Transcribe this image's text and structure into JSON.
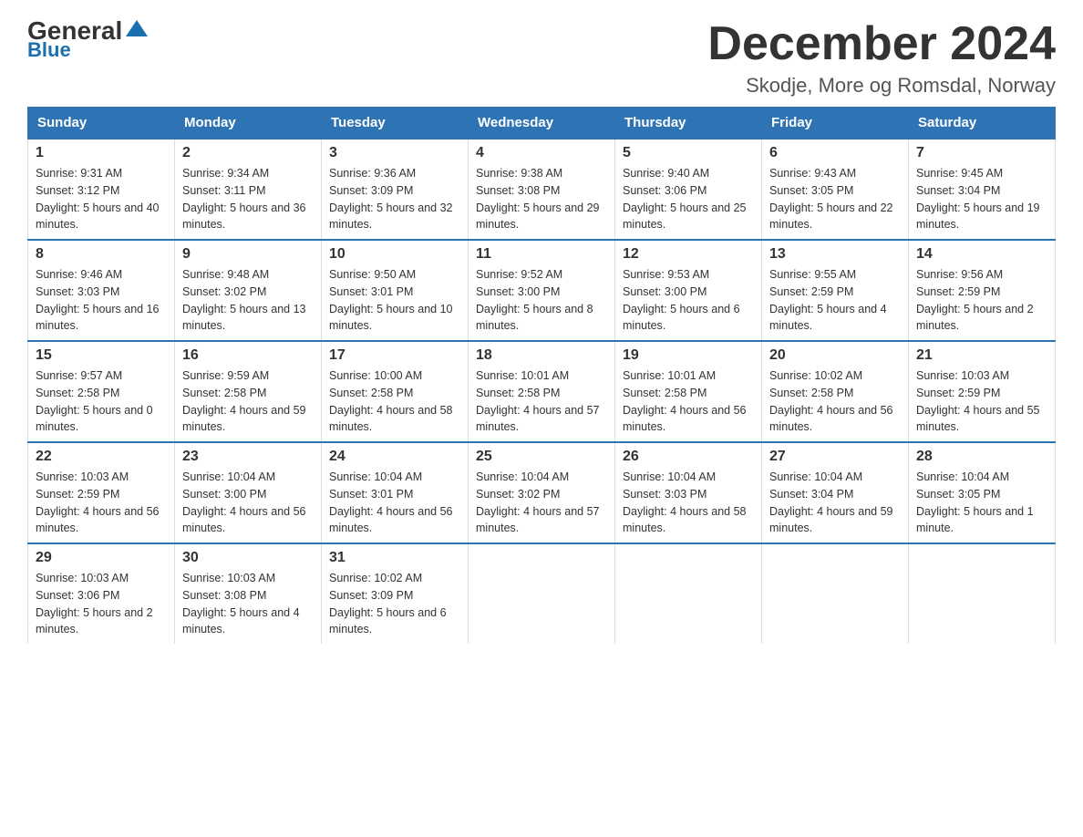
{
  "logo": {
    "general": "General",
    "blue": "Blue"
  },
  "header": {
    "month": "December 2024",
    "location": "Skodje, More og Romsdal, Norway"
  },
  "days_of_week": [
    "Sunday",
    "Monday",
    "Tuesday",
    "Wednesday",
    "Thursday",
    "Friday",
    "Saturday"
  ],
  "weeks": [
    [
      {
        "num": "1",
        "sunrise": "9:31 AM",
        "sunset": "3:12 PM",
        "daylight": "5 hours and 40 minutes."
      },
      {
        "num": "2",
        "sunrise": "9:34 AM",
        "sunset": "3:11 PM",
        "daylight": "5 hours and 36 minutes."
      },
      {
        "num": "3",
        "sunrise": "9:36 AM",
        "sunset": "3:09 PM",
        "daylight": "5 hours and 32 minutes."
      },
      {
        "num": "4",
        "sunrise": "9:38 AM",
        "sunset": "3:08 PM",
        "daylight": "5 hours and 29 minutes."
      },
      {
        "num": "5",
        "sunrise": "9:40 AM",
        "sunset": "3:06 PM",
        "daylight": "5 hours and 25 minutes."
      },
      {
        "num": "6",
        "sunrise": "9:43 AM",
        "sunset": "3:05 PM",
        "daylight": "5 hours and 22 minutes."
      },
      {
        "num": "7",
        "sunrise": "9:45 AM",
        "sunset": "3:04 PM",
        "daylight": "5 hours and 19 minutes."
      }
    ],
    [
      {
        "num": "8",
        "sunrise": "9:46 AM",
        "sunset": "3:03 PM",
        "daylight": "5 hours and 16 minutes."
      },
      {
        "num": "9",
        "sunrise": "9:48 AM",
        "sunset": "3:02 PM",
        "daylight": "5 hours and 13 minutes."
      },
      {
        "num": "10",
        "sunrise": "9:50 AM",
        "sunset": "3:01 PM",
        "daylight": "5 hours and 10 minutes."
      },
      {
        "num": "11",
        "sunrise": "9:52 AM",
        "sunset": "3:00 PM",
        "daylight": "5 hours and 8 minutes."
      },
      {
        "num": "12",
        "sunrise": "9:53 AM",
        "sunset": "3:00 PM",
        "daylight": "5 hours and 6 minutes."
      },
      {
        "num": "13",
        "sunrise": "9:55 AM",
        "sunset": "2:59 PM",
        "daylight": "5 hours and 4 minutes."
      },
      {
        "num": "14",
        "sunrise": "9:56 AM",
        "sunset": "2:59 PM",
        "daylight": "5 hours and 2 minutes."
      }
    ],
    [
      {
        "num": "15",
        "sunrise": "9:57 AM",
        "sunset": "2:58 PM",
        "daylight": "5 hours and 0 minutes."
      },
      {
        "num": "16",
        "sunrise": "9:59 AM",
        "sunset": "2:58 PM",
        "daylight": "4 hours and 59 minutes."
      },
      {
        "num": "17",
        "sunrise": "10:00 AM",
        "sunset": "2:58 PM",
        "daylight": "4 hours and 58 minutes."
      },
      {
        "num": "18",
        "sunrise": "10:01 AM",
        "sunset": "2:58 PM",
        "daylight": "4 hours and 57 minutes."
      },
      {
        "num": "19",
        "sunrise": "10:01 AM",
        "sunset": "2:58 PM",
        "daylight": "4 hours and 56 minutes."
      },
      {
        "num": "20",
        "sunrise": "10:02 AM",
        "sunset": "2:58 PM",
        "daylight": "4 hours and 56 minutes."
      },
      {
        "num": "21",
        "sunrise": "10:03 AM",
        "sunset": "2:59 PM",
        "daylight": "4 hours and 55 minutes."
      }
    ],
    [
      {
        "num": "22",
        "sunrise": "10:03 AM",
        "sunset": "2:59 PM",
        "daylight": "4 hours and 56 minutes."
      },
      {
        "num": "23",
        "sunrise": "10:04 AM",
        "sunset": "3:00 PM",
        "daylight": "4 hours and 56 minutes."
      },
      {
        "num": "24",
        "sunrise": "10:04 AM",
        "sunset": "3:01 PM",
        "daylight": "4 hours and 56 minutes."
      },
      {
        "num": "25",
        "sunrise": "10:04 AM",
        "sunset": "3:02 PM",
        "daylight": "4 hours and 57 minutes."
      },
      {
        "num": "26",
        "sunrise": "10:04 AM",
        "sunset": "3:03 PM",
        "daylight": "4 hours and 58 minutes."
      },
      {
        "num": "27",
        "sunrise": "10:04 AM",
        "sunset": "3:04 PM",
        "daylight": "4 hours and 59 minutes."
      },
      {
        "num": "28",
        "sunrise": "10:04 AM",
        "sunset": "3:05 PM",
        "daylight": "5 hours and 1 minute."
      }
    ],
    [
      {
        "num": "29",
        "sunrise": "10:03 AM",
        "sunset": "3:06 PM",
        "daylight": "5 hours and 2 minutes."
      },
      {
        "num": "30",
        "sunrise": "10:03 AM",
        "sunset": "3:08 PM",
        "daylight": "5 hours and 4 minutes."
      },
      {
        "num": "31",
        "sunrise": "10:02 AM",
        "sunset": "3:09 PM",
        "daylight": "5 hours and 6 minutes."
      },
      null,
      null,
      null,
      null
    ]
  ]
}
